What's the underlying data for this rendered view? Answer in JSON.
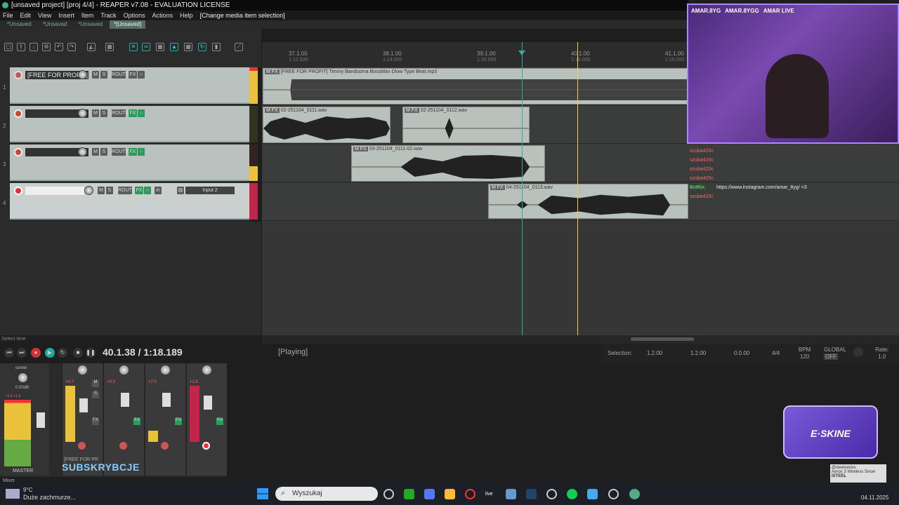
{
  "window": {
    "title": "[unsaved project] [proj 4/4] - REAPER v7.08 - EVALUATION LICENSE"
  },
  "menu": [
    "File",
    "Edit",
    "View",
    "Insert",
    "Item",
    "Track",
    "Options",
    "Actions",
    "Help",
    "[Change media item selection]"
  ],
  "project_tabs": [
    "*Unsaved",
    "*Unsaved",
    "*Unsaved",
    "*[Unsaved]"
  ],
  "ruler": [
    "37.1.00",
    "38.1.00",
    "39.1.00",
    "40.1.00",
    "41.1.00"
  ],
  "ruler_sub": [
    "1:12.000",
    "1:14.000",
    "1:16.000",
    "1:18.000",
    "1:20.000"
  ],
  "tracks": [
    {
      "num": "1",
      "name": "[FREE FOR PROFIT]",
      "route": "ROUTE"
    },
    {
      "num": "2",
      "name": "",
      "route": "ROUTE"
    },
    {
      "num": "3",
      "name": "",
      "route": "ROUTE"
    },
    {
      "num": "4",
      "name": "",
      "route": "ROUTE",
      "input": "Input 2"
    }
  ],
  "items": [
    {
      "name": "[FREE FOR PROFIT] Timmy Bandsoma BossMan Dlow Type Beat.mp3"
    },
    {
      "name": "02-251104_0111.wav"
    },
    {
      "name": "02-251104_0112.wav"
    },
    {
      "name": "03-251104_0111-02.wav"
    },
    {
      "name": "04-251104_0113.wav"
    }
  ],
  "transport": {
    "time": "40.1.38 / 1:18.189",
    "status": "[Playing]",
    "select_hint": "Select time"
  },
  "selection": {
    "label": "Selection:",
    "start": "1.2.00",
    "end": "1.2.00",
    "length": "0.0.00",
    "timesig": "4/4",
    "bpm_label": "BPM",
    "bpm": "120",
    "global": "GLOBAL",
    "global_off": "OFF",
    "rate_label": "Rate:",
    "rate": "1.0"
  },
  "mixer": {
    "pan": "center",
    "db": "0.00dB",
    "master": "MASTER",
    "mixer_tab": "Mixer",
    "strip_name": "[FREE FOR PR",
    "peaks": [
      "+4.7",
      "+0.3",
      "+7.0",
      "+2.0"
    ],
    "master_peak": "+1.3 +1.3"
  },
  "chat": [
    {
      "user": "szuba420c",
      "msg": ""
    },
    {
      "user": "szuba420c",
      "msg": ""
    },
    {
      "user": "szuba420c",
      "msg": ""
    },
    {
      "user": "szuba420c",
      "msg": ""
    },
    {
      "user": "BotRix:",
      "msg": "https://www.instagram.com/amar_8yg/ <3"
    },
    {
      "user": "szuba420c",
      "msg": ""
    }
  ],
  "webcam_handles": [
    "AMAR.8YG",
    "AMAR.8YGG",
    "AMAR LIVE"
  ],
  "overlay": {
    "brand": "E·SKINE",
    "subscribe": "SUBSKRYBCJE",
    "product": "Aerox 3 Wireless Snow",
    "maker": "@steelseries",
    "badge": "ISTEEL"
  },
  "taskbar": {
    "search_placeholder": "Wyszukaj",
    "weather": "Duże zachmurze...",
    "temp": "9°C",
    "date": "04.11.2025"
  },
  "colors": {
    "accent": "#2c9a5c",
    "rec": "#cc3333",
    "playhead": "#3aa6a0",
    "edit_cursor": "#e6d34a"
  }
}
